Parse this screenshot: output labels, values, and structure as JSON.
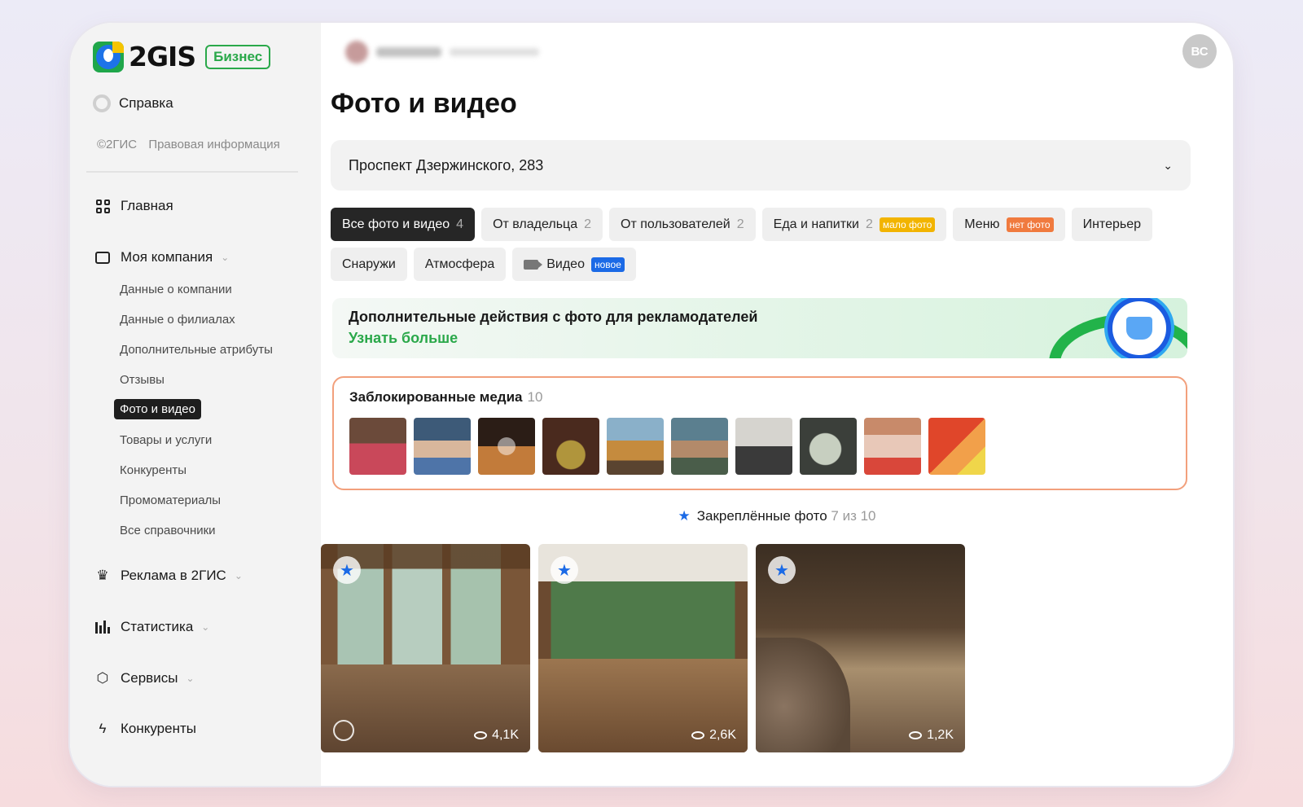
{
  "brand": {
    "logo_text": "2GIS",
    "badge": "Бизнес"
  },
  "sidebar": {
    "help": "Справка",
    "copyright": "©2ГИС",
    "legal": "Правовая информация",
    "nav": {
      "home": "Главная",
      "company": "Моя компания",
      "ads": "Реклама в 2ГИС",
      "stats": "Статистика",
      "services": "Сервисы",
      "competitors": "Конкуренты"
    },
    "company_items": [
      "Данные о компании",
      "Данные о филиалах",
      "Дополнительные атрибуты",
      "Отзывы",
      "Фото и видео",
      "Товары и услуги",
      "Конкуренты",
      "Промоматериалы",
      "Все справочники"
    ]
  },
  "header": {
    "user_initials": "ВС"
  },
  "main": {
    "title": "Фото и видео",
    "address": "Проспект Дзержинского, 283",
    "chips": [
      {
        "label": "Все фото и видео",
        "count": "4"
      },
      {
        "label": "От владельца",
        "count": "2"
      },
      {
        "label": "От пользователей",
        "count": "2"
      },
      {
        "label": "Еда и напитки",
        "count": "2",
        "tag": "мало фото"
      },
      {
        "label": "Меню",
        "tag": "нет фото"
      },
      {
        "label": "Интерьер"
      },
      {
        "label": "Снаружи"
      },
      {
        "label": "Атмосфера"
      },
      {
        "label": "Видео",
        "tag": "новое"
      }
    ],
    "promo": {
      "title": "Дополнительные действия с фото для рекламодателей",
      "link": "Узнать больше"
    },
    "blocked": {
      "title": "Заблокированные медиа",
      "count": "10"
    },
    "pinned": {
      "title": "Закреплённые фото",
      "count": "7 из 10"
    },
    "photos": [
      {
        "views": "4,1K"
      },
      {
        "views": "2,6K"
      },
      {
        "views": "1,2K"
      }
    ]
  },
  "colors": {
    "accent_blue": "#1b5be0",
    "brand_green": "#2aa84a",
    "tag_yellow": "#f2b400",
    "tag_orange": "#f07a3e",
    "blocked_border": "#f2a07c"
  }
}
